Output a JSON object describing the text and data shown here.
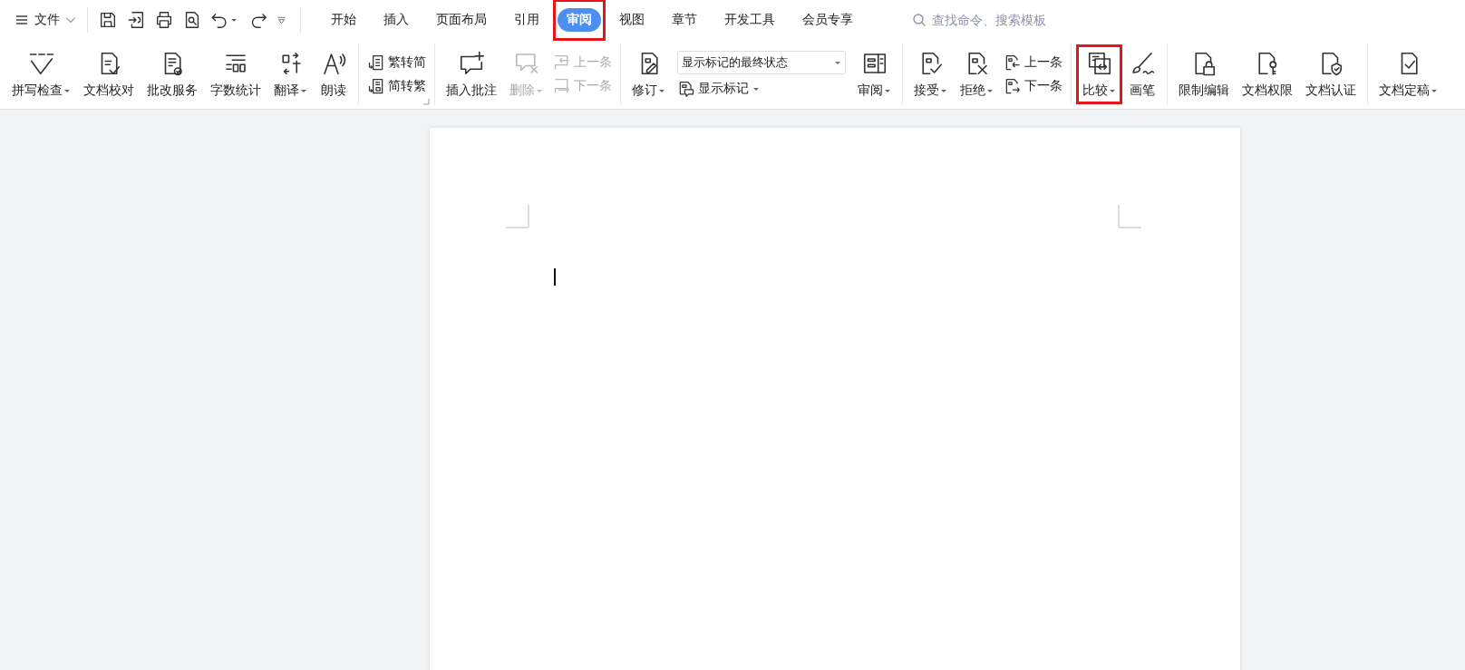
{
  "menu": {
    "label": "文件"
  },
  "tabs": [
    {
      "label": "开始",
      "selected": false,
      "highlighted": false
    },
    {
      "label": "插入",
      "selected": false,
      "highlighted": false
    },
    {
      "label": "页面布局",
      "selected": false,
      "highlighted": false
    },
    {
      "label": "引用",
      "selected": false,
      "highlighted": false
    },
    {
      "label": "审阅",
      "selected": true,
      "highlighted": true
    },
    {
      "label": "视图",
      "selected": false,
      "highlighted": false
    },
    {
      "label": "章节",
      "selected": false,
      "highlighted": false
    },
    {
      "label": "开发工具",
      "selected": false,
      "highlighted": false
    },
    {
      "label": "会员专享",
      "selected": false,
      "highlighted": false
    }
  ],
  "search": {
    "placeholder": "查找命令、搜索模板"
  },
  "ribbon": {
    "groups": [
      {
        "items": [
          {
            "kind": "large",
            "label": "拼写检查",
            "dropdown": true,
            "disabled": false,
            "highlighted": false
          },
          {
            "kind": "large",
            "label": "文档校对",
            "dropdown": false,
            "disabled": false,
            "highlighted": false
          },
          {
            "kind": "large",
            "label": "批改服务",
            "dropdown": false,
            "disabled": false,
            "highlighted": false
          },
          {
            "kind": "large",
            "label": "字数统计",
            "dropdown": false,
            "disabled": false,
            "highlighted": false
          },
          {
            "kind": "large",
            "label": "翻译",
            "dropdown": true,
            "disabled": false,
            "highlighted": false
          },
          {
            "kind": "large",
            "label": "朗读",
            "dropdown": false,
            "disabled": false,
            "highlighted": false
          }
        ]
      },
      {
        "launcher": true,
        "items": [
          {
            "kind": "stack",
            "buttons": [
              {
                "label": "繁转简",
                "disabled": false
              },
              {
                "label": "简转繁",
                "disabled": false
              }
            ]
          }
        ]
      },
      {
        "items": [
          {
            "kind": "large",
            "label": "插入批注",
            "dropdown": false,
            "disabled": false,
            "highlighted": false
          },
          {
            "kind": "large",
            "label": "删除",
            "dropdown": true,
            "disabled": true,
            "highlighted": false
          },
          {
            "kind": "stack",
            "buttons": [
              {
                "label": "上一条",
                "disabled": true
              },
              {
                "label": "下一条",
                "disabled": true
              }
            ]
          }
        ]
      },
      {
        "items": [
          {
            "kind": "large",
            "label": "修订",
            "dropdown": true,
            "disabled": false,
            "highlighted": false
          },
          {
            "kind": "select",
            "value": "显示标记的最终状态",
            "button": {
              "label": "显示标记",
              "dropdown": true
            }
          },
          {
            "kind": "large",
            "label": "审阅",
            "dropdown": true,
            "disabled": false,
            "highlighted": false
          }
        ]
      },
      {
        "items": [
          {
            "kind": "large",
            "label": "接受",
            "dropdown": true,
            "disabled": false,
            "highlighted": false
          },
          {
            "kind": "large",
            "label": "拒绝",
            "dropdown": true,
            "disabled": false,
            "highlighted": false
          },
          {
            "kind": "stack",
            "buttons": [
              {
                "label": "上一条",
                "disabled": false
              },
              {
                "label": "下一条",
                "disabled": false
              }
            ]
          }
        ]
      },
      {
        "items": [
          {
            "kind": "large",
            "label": "比较",
            "dropdown": true,
            "disabled": false,
            "highlighted": true
          },
          {
            "kind": "large",
            "label": "画笔",
            "dropdown": false,
            "disabled": false,
            "highlighted": false
          }
        ]
      },
      {
        "items": [
          {
            "kind": "large",
            "label": "限制编辑",
            "dropdown": false,
            "disabled": false,
            "highlighted": false
          },
          {
            "kind": "large",
            "label": "文档权限",
            "dropdown": false,
            "disabled": false,
            "highlighted": false
          },
          {
            "kind": "large",
            "label": "文档认证",
            "dropdown": false,
            "disabled": false,
            "highlighted": false
          }
        ]
      },
      {
        "items": [
          {
            "kind": "large",
            "label": "文档定稿",
            "dropdown": true,
            "disabled": false,
            "highlighted": false
          }
        ]
      }
    ]
  }
}
